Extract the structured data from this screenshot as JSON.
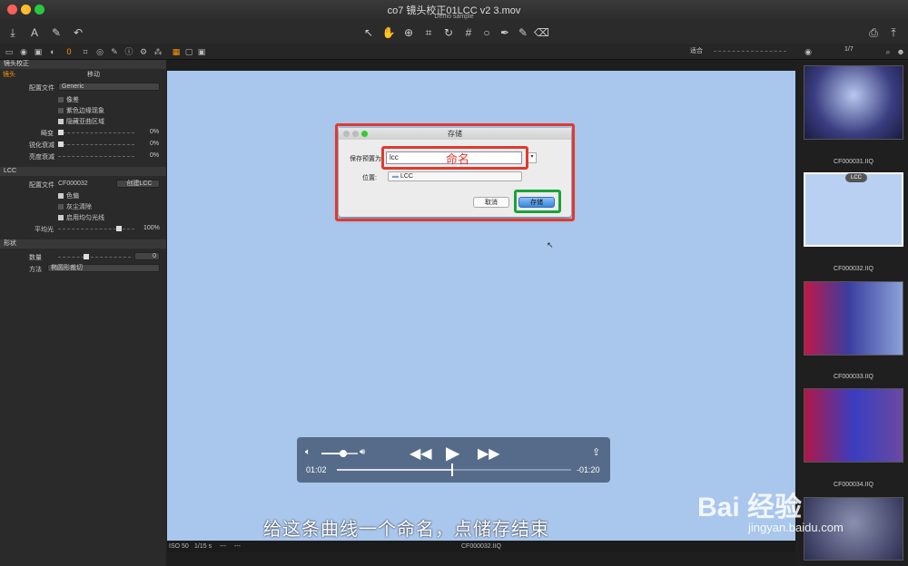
{
  "window": {
    "title": "co7 镜头校正01LCC v2 3.mov",
    "subtitle": "Demo sample",
    "banner": "我的作品"
  },
  "toolbar": {
    "right_label": "适合",
    "page_count": "1/7"
  },
  "left_panel": {
    "sec1_title": "镜头校正",
    "tab_lens": "镜头",
    "tab_move": "移动",
    "profile_label": "配置文件",
    "profile_value": "Generic",
    "chk1": "像差",
    "chk2": "紫色边缘现象",
    "chk3": "隐藏亚曲区域",
    "s1_label": "畸变",
    "s1_val": "0%",
    "s2_label": "锐化衰减",
    "s2_val": "0%",
    "s3_label": "亮度衰减",
    "s3_val": "0%",
    "sec2_title": "LCC",
    "lcc_profile_label": "配置文件",
    "lcc_profile_value": "CF000032",
    "create_lcc": "创建LCC",
    "lchk1": "色偏",
    "lchk2": "灰尘清除",
    "lchk3": "启用均匀光线",
    "uniform_label": "平均光",
    "uniform_val": "100%",
    "sec3_title": "形状",
    "amount_label": "数量",
    "amount_val": "0",
    "method_label": "方法",
    "method_value": "椭圆形裁切"
  },
  "dialog": {
    "title": "存储",
    "save_preset_label": "保存预置为:",
    "name_value": "lcc",
    "annotation": "命名",
    "location_label": "位置:",
    "location_value": "LCC",
    "cancel_label": "取消",
    "save_label": "存储"
  },
  "player": {
    "time_elapsed": "01:02",
    "time_remaining": "-01:20",
    "progress": 0.49,
    "volume": 0.6
  },
  "subtitle": "给这条曲线一个命名，点储存结束",
  "status": {
    "iso": "ISO 50",
    "shutter": "1/15 s",
    "dash1": "---",
    "dash2": "---",
    "filename": "CF000032.IIQ"
  },
  "thumbnails": [
    {
      "name": "CF000031.IIQ"
    },
    {
      "name": "CF000032.IIQ",
      "badge": "LCC"
    },
    {
      "name": "CF000033.IIQ"
    },
    {
      "name": "CF000034.IIQ"
    }
  ],
  "watermark": {
    "brand": "Bai 经验",
    "url": "jingyan.baidu.com"
  }
}
